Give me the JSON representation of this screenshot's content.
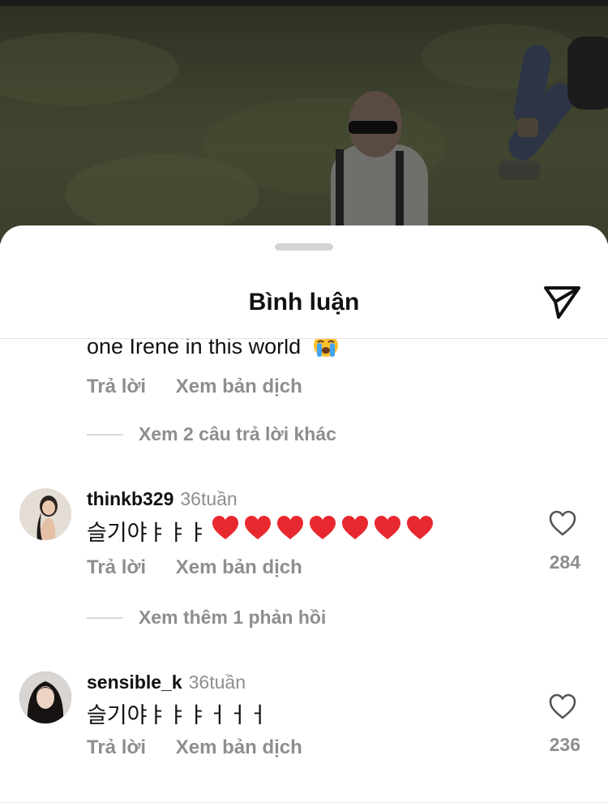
{
  "sheet": {
    "title": "Bình luận",
    "send_icon": "paper-plane-icon"
  },
  "partial_comment": {
    "text": "one Irene in this world",
    "emoji": "loudly-crying-face-emoji",
    "reply_label": "Trả lời",
    "translate_label": "Xem bản dịch",
    "more_replies": "Xem 2 câu trả lời khác"
  },
  "comments": [
    {
      "username": "thinkb329",
      "time": "36tuần",
      "text": "슬기야ㅑㅑㅑ",
      "hearts": 7,
      "likes": "284",
      "reply_label": "Trả lời",
      "translate_label": "Xem bản dịch",
      "more_replies": "Xem thêm 1 phản hồi"
    },
    {
      "username": "sensible_k",
      "time": "36tuần",
      "text": "슬기야ㅑㅑㅑㅓㅓㅓ",
      "likes": "236",
      "reply_label": "Trả lời",
      "translate_label": "Xem bản dịch"
    }
  ],
  "colors": {
    "heart_red": "#e8282f",
    "muted_text": "#8e8e8e",
    "primary_text": "#111111"
  }
}
